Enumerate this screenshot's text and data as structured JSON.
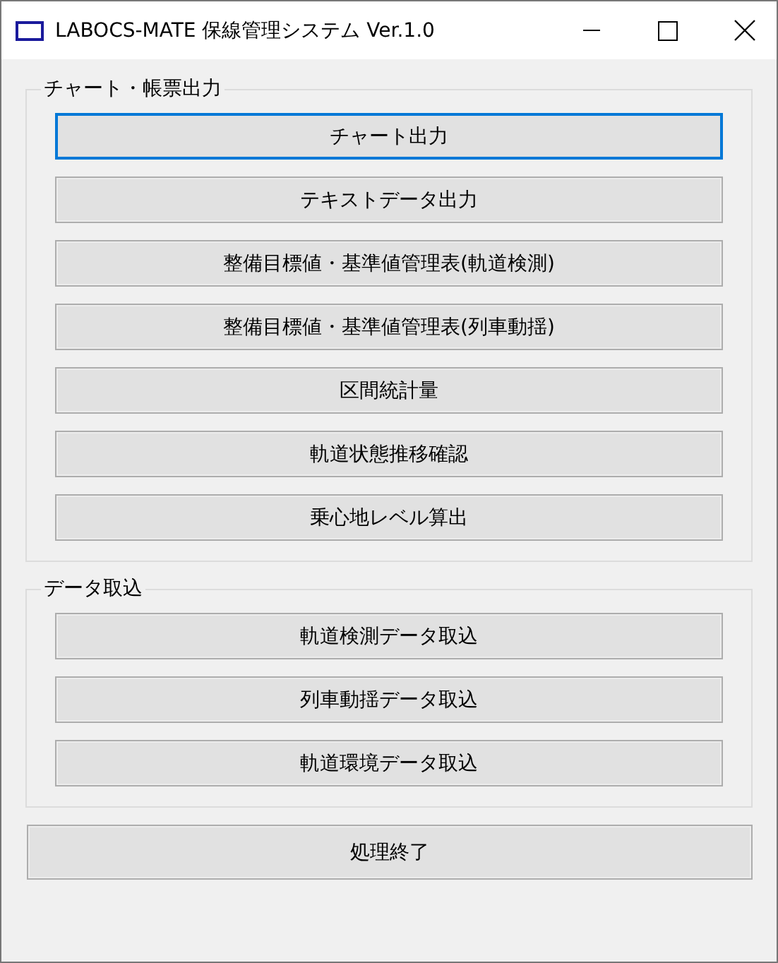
{
  "window": {
    "title": "LABOCS-MATE 保線管理システム Ver.1.0"
  },
  "groups": [
    {
      "title": "チャート・帳票出力",
      "buttons": [
        {
          "label": "チャート出力",
          "focused": true
        },
        {
          "label": "テキストデータ出力",
          "focused": false
        },
        {
          "label": "整備目標値・基準値管理表(軌道検測)",
          "focused": false
        },
        {
          "label": "整備目標値・基準値管理表(列車動揺)",
          "focused": false
        },
        {
          "label": "区間統計量",
          "focused": false
        },
        {
          "label": "軌道状態推移確認",
          "focused": false
        },
        {
          "label": "乗心地レベル算出",
          "focused": false
        }
      ]
    },
    {
      "title": "データ取込",
      "buttons": [
        {
          "label": "軌道検測データ取込",
          "focused": false
        },
        {
          "label": "列車動揺データ取込",
          "focused": false
        },
        {
          "label": "軌道環境データ取込",
          "focused": false
        }
      ]
    }
  ],
  "exit_button": {
    "label": "処理終了"
  }
}
